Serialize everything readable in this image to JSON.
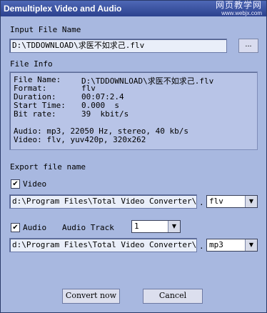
{
  "window": {
    "title": "Demultiplex Video and Audio"
  },
  "watermark": {
    "main": "网页教学网",
    "url": "www.webjx.com"
  },
  "input": {
    "section_label": "Input File Name",
    "path": "D:\\TDDOWNLOAD\\求医不如求己.flv",
    "browse_label": "..."
  },
  "info": {
    "section_label": "File Info",
    "rows": [
      {
        "label": "File Name:",
        "value": "D:\\TDDOWNLOAD\\求医不如求己.flv"
      },
      {
        "label": "Format:",
        "value": "flv"
      },
      {
        "label": "Duration:",
        "value": "00:07:2.4"
      },
      {
        "label": "Start Time:",
        "value": "0.000  s"
      },
      {
        "label": "Bit rate:",
        "value": "39  kbit/s"
      }
    ],
    "audio_line": "Audio: mp3, 22050 Hz, stereo, 40 kb/s",
    "video_line": "Video: flv, yuv420p, 320x262"
  },
  "export": {
    "section_label": "Export file name",
    "video": {
      "label": "Video",
      "checked": true,
      "path": "d:\\Program Files\\Total Video Converter\\Conv",
      "format": "flv"
    },
    "audio": {
      "label": "Audio",
      "checked": true,
      "track_label": "Audio Track",
      "track_value": "1",
      "path": "d:\\Program Files\\Total Video Converter\\Conv",
      "format": "mp3"
    }
  },
  "buttons": {
    "convert": "Convert now",
    "cancel": "Cancel"
  }
}
